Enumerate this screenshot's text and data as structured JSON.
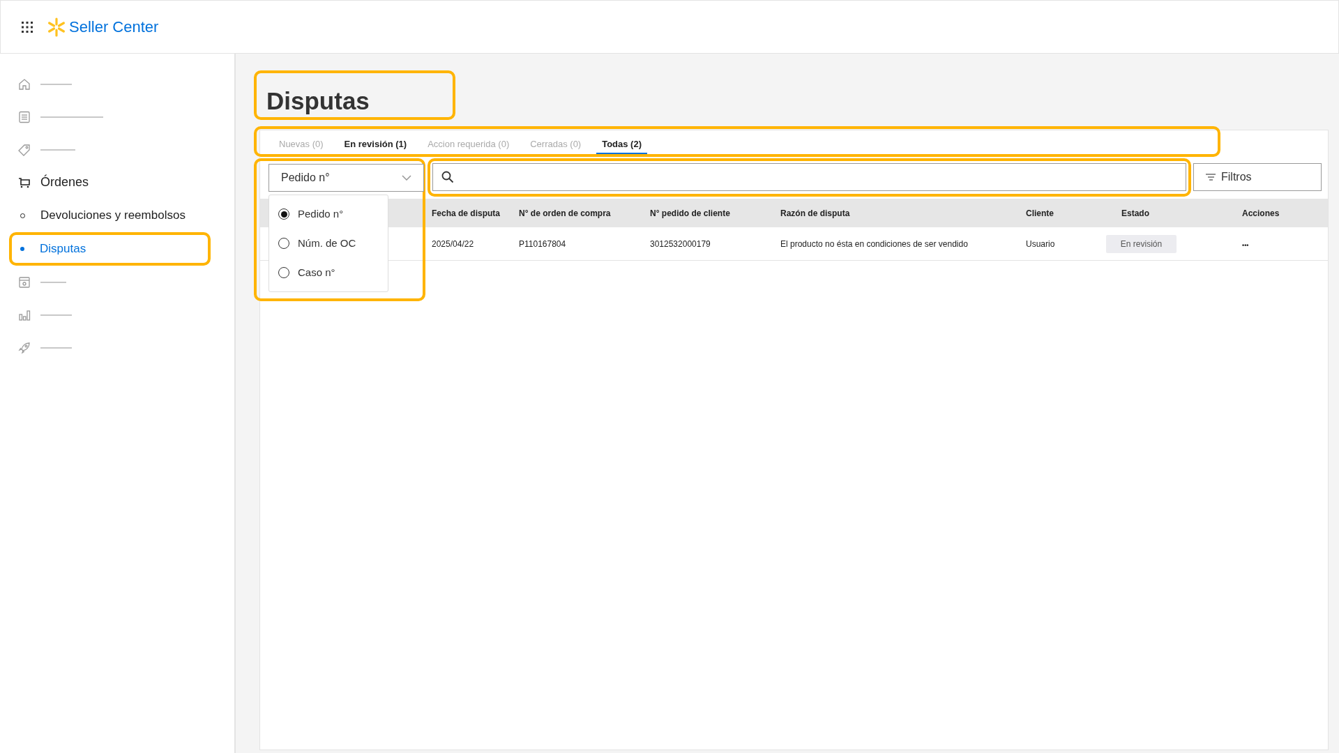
{
  "header": {
    "title": "Seller Center"
  },
  "sidebar": {
    "items": [
      {
        "kind": "redacted"
      },
      {
        "kind": "redacted"
      },
      {
        "kind": "redacted"
      },
      {
        "kind": "link",
        "label": "Órdenes",
        "children": [
          {
            "label": "Devoluciones y reembolsos",
            "selected": false,
            "highlighted": false
          },
          {
            "label": "Disputas",
            "selected": true,
            "highlighted": true
          }
        ]
      },
      {
        "kind": "redacted"
      },
      {
        "kind": "redacted"
      },
      {
        "kind": "redacted"
      }
    ]
  },
  "page": {
    "title": "Disputas",
    "highlighted": true
  },
  "tabs": {
    "highlighted": true,
    "items": [
      {
        "label": "Nuevas (0)",
        "selected": false,
        "disabled": true
      },
      {
        "label": "En revisión (1)",
        "selected": false,
        "disabled": false
      },
      {
        "label": "Accion requerida (0)",
        "selected": false,
        "disabled": true
      },
      {
        "label": "Cerradas (0)",
        "selected": false,
        "disabled": true
      },
      {
        "label": "Todas (2)",
        "selected": true,
        "disabled": false
      }
    ]
  },
  "search_type": {
    "value": "Pedido n°",
    "highlighted": true,
    "expanded": true,
    "options": [
      {
        "label": "Pedido n°",
        "selected": true
      },
      {
        "label": "Núm. de OC",
        "selected": false
      },
      {
        "label": "Caso n°",
        "selected": false
      }
    ]
  },
  "search": {
    "highlighted": true
  },
  "filters_button": "Filtros",
  "table": {
    "columns": [
      "Fecha de disputa",
      "N° de orden de compra",
      "N° pedido de cliente",
      "Razón de disputa",
      "Cliente",
      "Estado",
      "Acciones"
    ],
    "rows": [
      {
        "cells": [
          "2025/04/22",
          "P110167804",
          "3012532000179",
          "El producto no ésta en condiciones de ser vendido",
          "Usuario"
        ],
        "status": "En revisión",
        "actions": "•••"
      }
    ]
  }
}
